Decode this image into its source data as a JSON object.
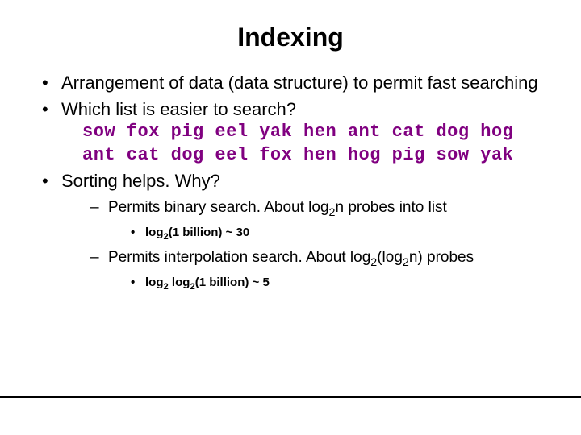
{
  "title": "Indexing",
  "bullets": {
    "b1": "Arrangement of data (data structure) to permit fast searching",
    "b2": "Which list is easier to search?",
    "row1": "sow fox pig eel yak hen ant cat dog hog",
    "row2": "ant cat dog eel fox hen hog pig sow yak",
    "b3": "Sorting helps.  Why?",
    "sub1a_pre": "Permits binary search.  About log",
    "sub1a_sub": "2",
    "sub1a_post": "n probes into list",
    "sub1a_detail_pre": "log",
    "sub1a_detail_sub": "2",
    "sub1a_detail_post": "(1 billion) ~ 30",
    "sub1b_pre": "Permits interpolation search.  About log",
    "sub1b_sub1": "2",
    "sub1b_mid": "(log",
    "sub1b_sub2": "2",
    "sub1b_post": "n) probes",
    "sub1b_detail_p1": "log",
    "sub1b_detail_s1": "2",
    "sub1b_detail_p2": " log",
    "sub1b_detail_s2": "2",
    "sub1b_detail_p3": "(1 billion) ~ 5"
  }
}
